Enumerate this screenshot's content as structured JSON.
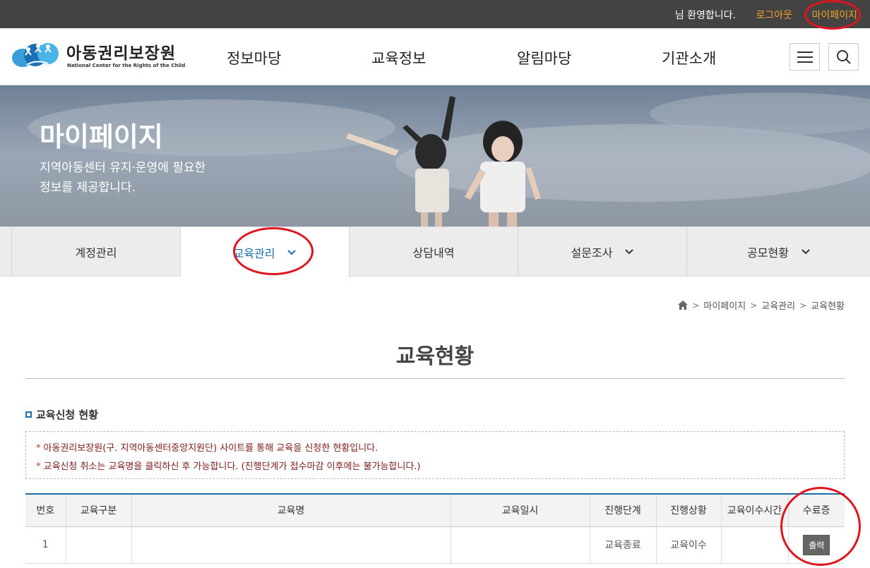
{
  "topbar": {
    "welcome": "님 환영합니다.",
    "logout": "로그아웃",
    "mypage": "마이페이지"
  },
  "header": {
    "logo_name": "아동권리보장원",
    "logo_sub": "National Center for the Rights of the Child",
    "nav": [
      "정보마당",
      "교육정보",
      "알림마당",
      "기관소개"
    ],
    "menu_icon": "hamburger-menu-icon",
    "search_icon": "search-icon"
  },
  "hero": {
    "title": "마이페이지",
    "desc_line1": "지역아동센터 유지·운영에 필요한",
    "desc_line2": "정보를 제공합니다."
  },
  "subnav": {
    "tabs": [
      {
        "label": "계정관리",
        "chevron": false
      },
      {
        "label": "교육관리",
        "chevron": true,
        "active": true
      },
      {
        "label": "상담내역",
        "chevron": false
      },
      {
        "label": "설문조사",
        "chevron": true
      },
      {
        "label": "공모현황",
        "chevron": true
      }
    ]
  },
  "breadcrumb": {
    "home_icon": "home-icon",
    "items": [
      "마이페이지",
      "교육관리",
      "교육현황"
    ]
  },
  "page_title": "교육현황",
  "section_title": "교육신청 현황",
  "notice": {
    "line1": "아동권리보장원(구. 지역아동센터중앙지원단) 사이트를 통해 교육을 신청한 현황입니다.",
    "line2": "교육신청 취소는 교육명을 클릭하신 후 가능합니다. (진행단계가 접수마감 이후에는 불가능합니다.)"
  },
  "table": {
    "headers": [
      "번호",
      "교육구분",
      "교육명",
      "교육일시",
      "진행단계",
      "진행상황",
      "교육이수시간",
      "수료증"
    ],
    "rows": [
      {
        "no": "1",
        "category": "",
        "name": "",
        "datetime": "",
        "stage": "교육종료",
        "status": "교육이수",
        "hours": "",
        "cert_button": "출력"
      }
    ]
  },
  "colors": {
    "accent": "#1a6fa8",
    "topbar_bg": "#434343",
    "link_orange": "#f0a22a",
    "annotation_red": "#e0141b"
  }
}
